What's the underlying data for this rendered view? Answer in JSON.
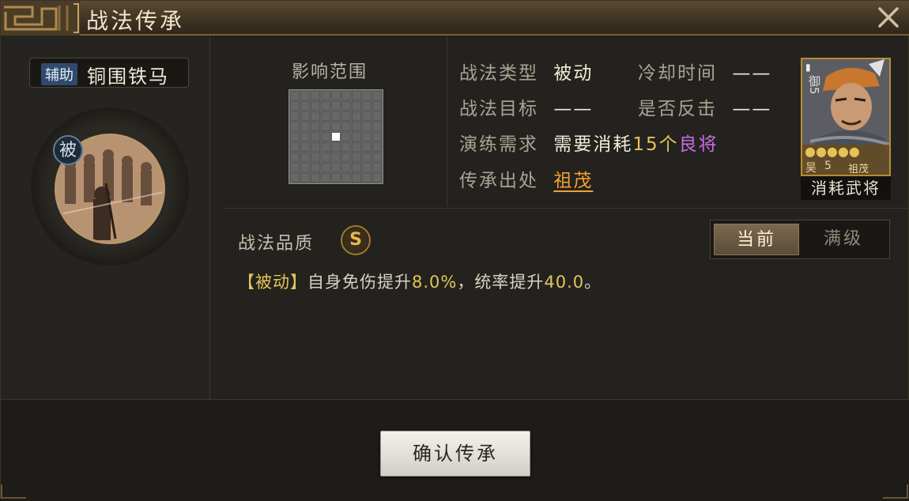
{
  "window": {
    "title": "战法传承",
    "close_icon": "close-icon"
  },
  "skill": {
    "tag": "辅助",
    "name": "铜围铁马",
    "type_badge": "被"
  },
  "range": {
    "label": "影响范围",
    "grid_cols": 9,
    "grid_rows": 9,
    "highlighted_cell": [
      4,
      4
    ]
  },
  "info": {
    "type_label": "战法类型",
    "type_value": "被动",
    "cooldown_label": "冷却时间",
    "cooldown_value": "——",
    "target_label": "战法目标",
    "target_value": "——",
    "counter_label": "是否反击",
    "counter_value": "——",
    "practice_label": "演练需求",
    "practice_prefix": "需要消耗",
    "practice_count": "15个",
    "practice_item": "良将",
    "source_label": "传承出处",
    "source_value": "祖茂"
  },
  "hero_card": {
    "top_mark": "▮",
    "rank": "御5",
    "stars": "●●●●●",
    "faction": "吴",
    "level": "5",
    "name": "祖茂",
    "caption": "消耗武将"
  },
  "quality": {
    "label": "战法品质",
    "grade": "S"
  },
  "tabs": {
    "current": "当前",
    "max": "满级"
  },
  "description": {
    "bracket": "【被动】",
    "part1": "自身免伤提升",
    "value1": "8.0%",
    "part2": "，统率提升",
    "value2": "40.0",
    "end": "。"
  },
  "footer": {
    "confirm_label": "确认传承"
  },
  "colors": {
    "gold": "#e0c65a",
    "purple": "#c66ce6",
    "orange": "#f2a032",
    "accent_border": "#b58c34"
  }
}
